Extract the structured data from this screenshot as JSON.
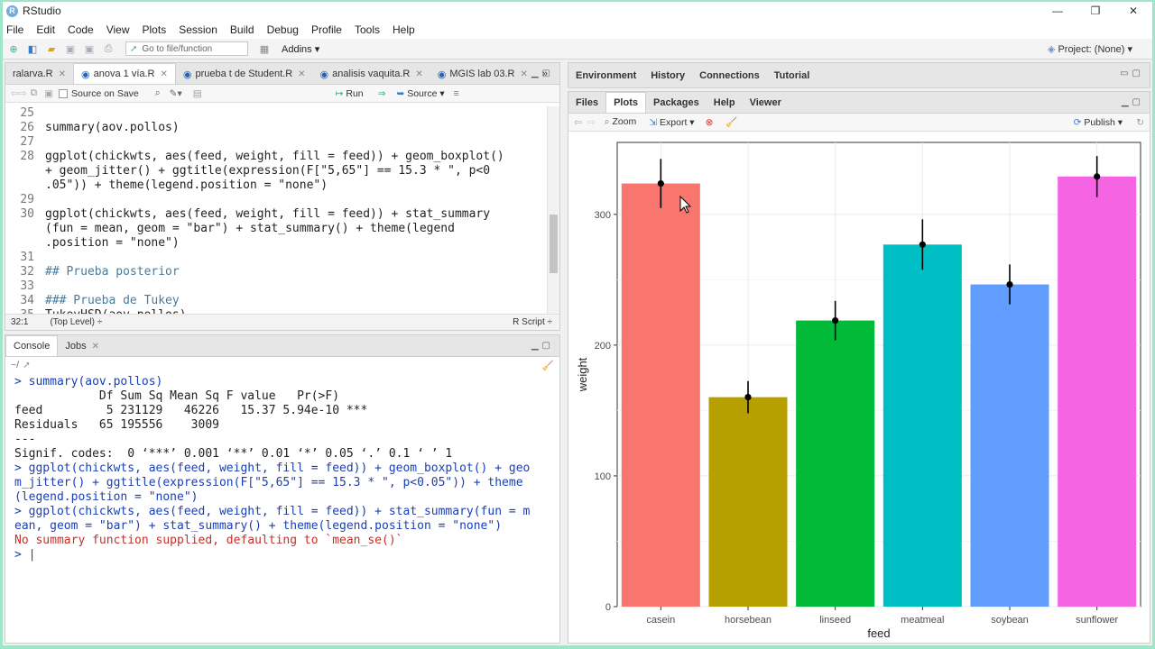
{
  "window": {
    "app_name": "RStudio",
    "min": "—",
    "max": "❐",
    "close": "✕"
  },
  "menu": [
    "File",
    "Edit",
    "Code",
    "View",
    "Plots",
    "Session",
    "Build",
    "Debug",
    "Profile",
    "Tools",
    "Help"
  ],
  "toolbar": {
    "goto_placeholder": "Go to file/function",
    "addins": "Addins",
    "project": "Project: (None)"
  },
  "source": {
    "tabs": [
      {
        "label": "ralarva.R",
        "active": false
      },
      {
        "label": "anova 1 vía.R",
        "active": true
      },
      {
        "label": "prueba t de Student.R",
        "active": false
      },
      {
        "label": "analisis vaquita.R",
        "active": false
      },
      {
        "label": "MGIS lab 03.R",
        "active": false
      }
    ],
    "source_on_save": "Source on Save",
    "run": "Run",
    "source_btn": "Source",
    "lines": [
      {
        "n": "25",
        "t": "",
        "type": "code"
      },
      {
        "n": "26",
        "t": "summary(aov.pollos)",
        "type": "code"
      },
      {
        "n": "27",
        "t": "",
        "type": "code"
      },
      {
        "n": "28",
        "t": "ggplot(chickwts, aes(feed, weight, fill = feed)) + geom_boxplot()",
        "type": "code"
      },
      {
        "n": "",
        "t": "+ geom_jitter() + ggtitle(expression(F[\"5,65\"] == 15.3 * \", p<0",
        "type": "code"
      },
      {
        "n": "",
        "t": ".05\")) + theme(legend.position = \"none\")",
        "type": "code"
      },
      {
        "n": "29",
        "t": "",
        "type": "code"
      },
      {
        "n": "30",
        "t": "ggplot(chickwts, aes(feed, weight, fill = feed)) + stat_summary",
        "type": "code"
      },
      {
        "n": "",
        "t": "(fun = mean, geom = \"bar\") + stat_summary() + theme(legend",
        "type": "code"
      },
      {
        "n": "",
        "t": ".position = \"none\")",
        "type": "code"
      },
      {
        "n": "31",
        "t": "",
        "type": "code"
      },
      {
        "n": "32",
        "t": "## Prueba posterior",
        "type": "comment"
      },
      {
        "n": "33",
        "t": "",
        "type": "code"
      },
      {
        "n": "34",
        "t": "### Prueba de Tukey",
        "type": "comment"
      },
      {
        "n": "35",
        "t": "TukeyHSD(aov.pollos)",
        "type": "code"
      }
    ],
    "status_pos": "32:1",
    "status_scope": "(Top Level) ÷",
    "status_lang": "R Script ÷"
  },
  "console": {
    "tabs": [
      {
        "label": "Console",
        "active": true
      },
      {
        "label": "Jobs",
        "active": false
      }
    ],
    "path": "~/",
    "lines": [
      {
        "t": "> summary(aov.pollos)",
        "c": "blue"
      },
      {
        "t": "            Df Sum Sq Mean Sq F value   Pr(>F)    ",
        "c": "black"
      },
      {
        "t": "feed         5 231129   46226   15.37 5.94e-10 ***",
        "c": "black"
      },
      {
        "t": "Residuals   65 195556    3009                     ",
        "c": "black"
      },
      {
        "t": "---",
        "c": "black"
      },
      {
        "t": "Signif. codes:  0 ‘***’ 0.001 ‘**’ 0.01 ‘*’ 0.05 ‘.’ 0.1 ‘ ’ 1",
        "c": "black"
      },
      {
        "t": "> ggplot(chickwts, aes(feed, weight, fill = feed)) + geom_boxplot() + geo",
        "c": "blue"
      },
      {
        "t": "m_jitter() + ggtitle(expression(F[\"5,65\"] == 15.3 * \", p<0.05\")) + theme",
        "c": "blue"
      },
      {
        "t": "(legend.position = \"none\")",
        "c": "blue"
      },
      {
        "t": "> ggplot(chickwts, aes(feed, weight, fill = feed)) + stat_summary(fun = m",
        "c": "blue"
      },
      {
        "t": "ean, geom = \"bar\") + stat_summary() + theme(legend.position = \"none\")",
        "c": "blue"
      },
      {
        "t": "No summary function supplied, defaulting to `mean_se()`",
        "c": "red"
      },
      {
        "t": "> |",
        "c": "blue"
      }
    ]
  },
  "env_pane": {
    "tabs": [
      "Environment",
      "History",
      "Connections",
      "Tutorial"
    ]
  },
  "files_pane": {
    "tabs": [
      {
        "label": "Files",
        "active": false
      },
      {
        "label": "Plots",
        "active": true
      },
      {
        "label": "Packages",
        "active": false
      },
      {
        "label": "Help",
        "active": false
      },
      {
        "label": "Viewer",
        "active": false
      }
    ],
    "zoom": "Zoom",
    "export": "Export",
    "publish": "Publish"
  },
  "chart_data": {
    "type": "bar",
    "categories": [
      "casein",
      "horsebean",
      "linseed",
      "meatmeal",
      "soybean",
      "sunflower"
    ],
    "values": [
      323.6,
      160.2,
      218.8,
      276.9,
      246.4,
      328.9
    ],
    "errors": [
      18.8,
      12.3,
      15.0,
      19.3,
      15.3,
      15.7
    ],
    "colors": [
      "#F8766D",
      "#B79F00",
      "#00BA38",
      "#00BFC4",
      "#619CFF",
      "#F564E3"
    ],
    "xlabel": "feed",
    "ylabel": "weight",
    "yticks": [
      0,
      100,
      200,
      300
    ],
    "ylim": [
      0,
      355
    ],
    "grid": true,
    "legend": "none"
  }
}
